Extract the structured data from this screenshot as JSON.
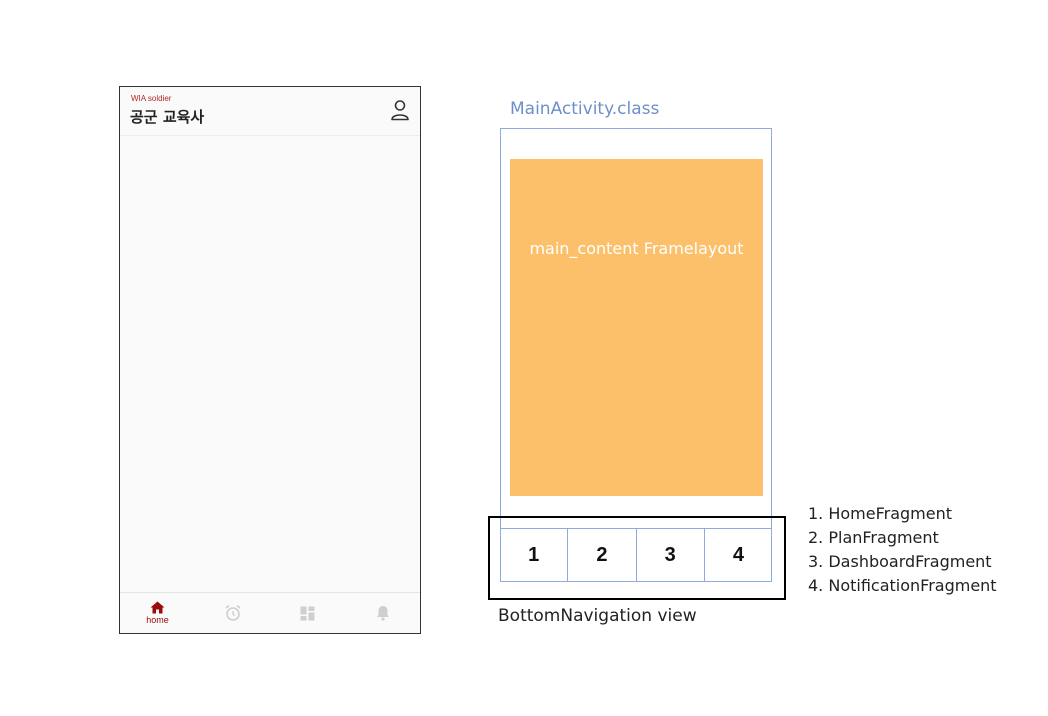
{
  "phone": {
    "brand_sub": "WIA soldier",
    "brand_title": "공군 교육사",
    "header_icon": "user-icon",
    "nav": [
      {
        "icon": "home-icon",
        "label": "home",
        "active": true
      },
      {
        "icon": "alarm-clock-icon",
        "label": "",
        "active": false
      },
      {
        "icon": "dashboard-icon",
        "label": "",
        "active": false
      },
      {
        "icon": "bell-icon",
        "label": "",
        "active": false
      }
    ],
    "colors": {
      "active": "#9b0b0b",
      "inactive": "#cfcfcf"
    }
  },
  "diagram": {
    "activity_label": "MainActivity.class",
    "content_label": "main_content Framelayout",
    "nav_cells": [
      "1",
      "2",
      "3",
      "4"
    ],
    "bottom_nav_label": "BottomNavigation view",
    "fragments": [
      "1. HomeFragment",
      "2. PlanFragment",
      "3. DashboardFragment",
      "4. NotificationFragment"
    ],
    "colors": {
      "frame": "#fcc06a",
      "outline": "#8faadc",
      "activity_label": "#6e8fca"
    }
  }
}
